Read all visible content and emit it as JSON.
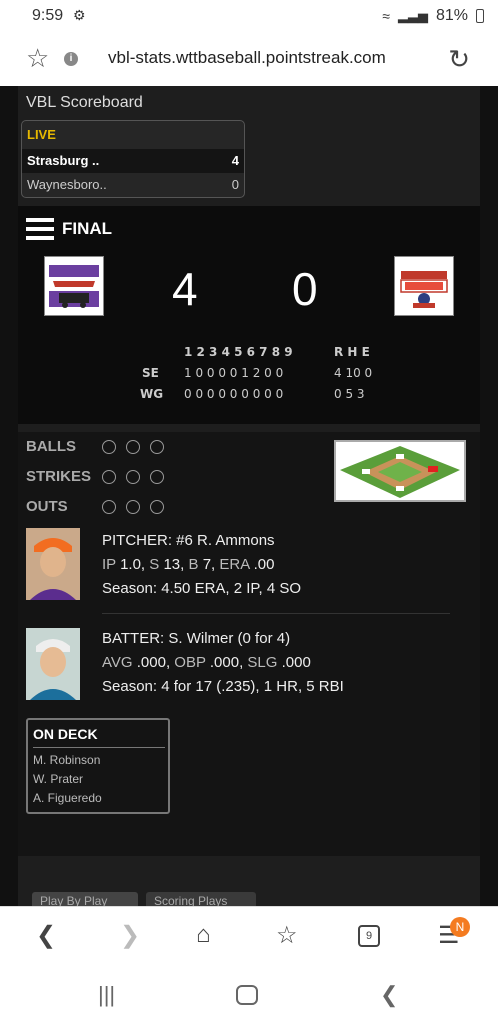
{
  "status_bar": {
    "time": "9:59",
    "battery": "81%"
  },
  "browser": {
    "url": "vbl-stats.wttbaseball.pointstreak.com",
    "tab_count": "9",
    "badge": "N"
  },
  "scoreboard": {
    "title": "VBL Scoreboard",
    "live_label": "LIVE",
    "games": [
      {
        "team": "Strasburg ..",
        "score": "4"
      },
      {
        "team": "Waynesboro..",
        "score": "0"
      }
    ]
  },
  "game": {
    "status": "FINAL",
    "away_score": "4",
    "home_score": "0",
    "linescore": {
      "innings_header": "1 2 3 4 5 6 7 8 9",
      "rhe_header": "R H E",
      "rows": [
        {
          "team": "SE",
          "innings": "1 0 0 0 0 1 2 0 0",
          "rhe": "4 10 0"
        },
        {
          "team": "WG",
          "innings": "0 0 0 0 0 0 0 0 0",
          "rhe": "0 5 3"
        }
      ]
    }
  },
  "count": {
    "balls_label": "BALLS",
    "strikes_label": "STRIKES",
    "outs_label": "OUTS"
  },
  "pitcher": {
    "title": "PITCHER: #6 R. Ammons",
    "ip_label": "IP",
    "ip": "1.0,",
    "s_label": "S",
    "s": "13,",
    "b_label": "B",
    "b": "7,",
    "era_label": "ERA",
    "era": ".00",
    "season": "Season: 4.50 ERA, 2 IP, 4 SO"
  },
  "batter": {
    "title": "BATTER: S. Wilmer (0 for 4)",
    "avg_label": "AVG",
    "avg": ".000,",
    "obp_label": "OBP",
    "obp": ".000,",
    "slg_label": "SLG",
    "slg": ".000",
    "season": "Season: 4 for 17 (.235), 1 HR, 5 RBI"
  },
  "on_deck": {
    "title": "ON DECK",
    "players": [
      "M. Robinson",
      "W. Prater",
      "A. Figueredo"
    ]
  },
  "tabs": [
    "Play By Play",
    "Scoring Plays"
  ]
}
